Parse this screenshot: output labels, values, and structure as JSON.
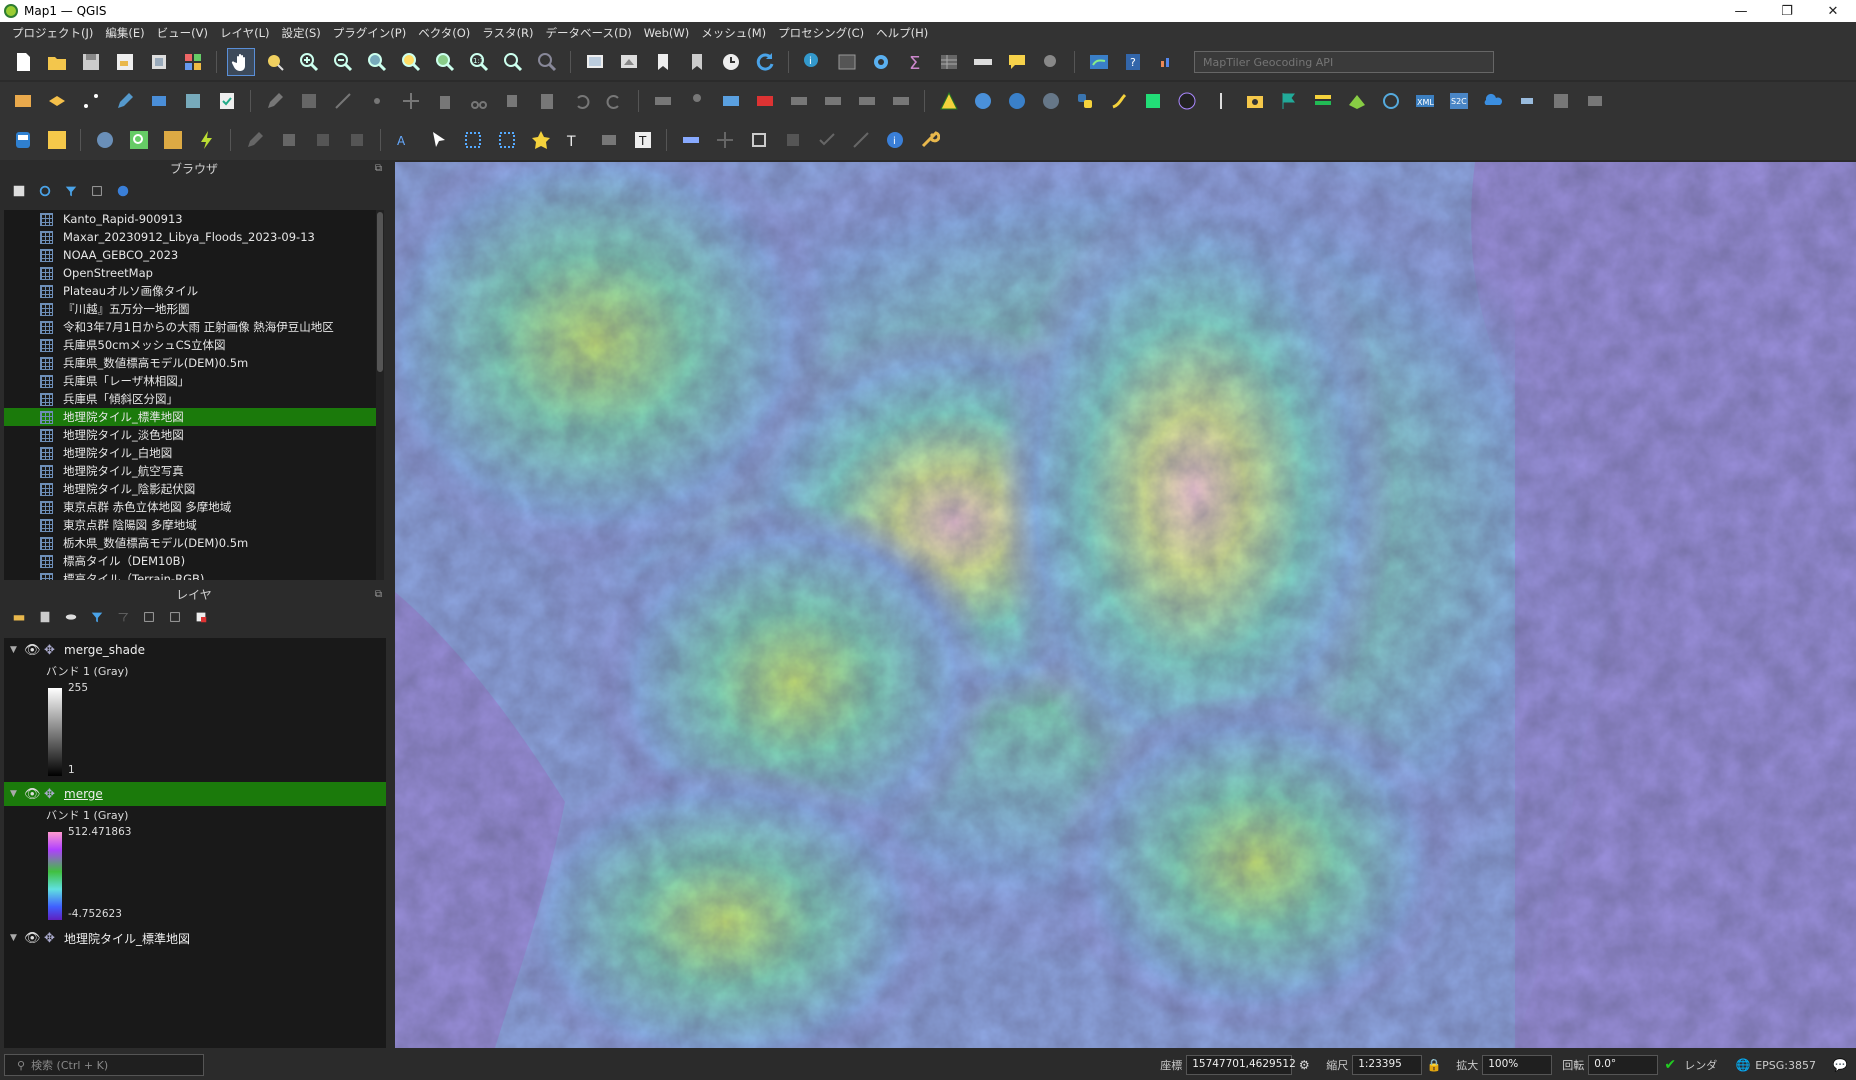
{
  "window": {
    "title": "Map1 — QGIS",
    "minimize": "—",
    "maximize": "❐",
    "close": "✕"
  },
  "menu": [
    "プロジェクト(J)",
    "編集(E)",
    "ビュー(V)",
    "レイヤ(L)",
    "設定(S)",
    "プラグイン(P)",
    "ベクタ(O)",
    "ラスタ(R)",
    "データベース(D)",
    "Web(W)",
    "メッシュ(M)",
    "プロセシング(C)",
    "ヘルプ(H)"
  ],
  "geocoder": {
    "placeholder": "MapTiler Geocoding API"
  },
  "browser": {
    "title": "ブラウザ",
    "items": [
      "Kanto_Rapid-900913",
      "Maxar_20230912_Libya_Floods_2023-09-13",
      "NOAA_GEBCO_2023",
      "OpenStreetMap",
      "Plateauオルソ画像タイル",
      "『川越』五万分一地形圖",
      "令和3年7月1日からの大雨 正射画像 熱海伊豆山地区",
      "兵庫県50cmメッシュCS立体図",
      "兵庫県_数値標高モデル(DEM)0.5m",
      "兵庫県「レーザ林相図」",
      "兵庫県「傾斜区分図」",
      "地理院タイル_標準地図",
      "地理院タイル_淡色地図",
      "地理院タイル_白地図",
      "地理院タイル_航空写真",
      "地理院タイル_陰影起伏図",
      "東京点群 赤色立体地図 多摩地域",
      "東京点群 陰陽図 多摩地域",
      "栃木県_数値標高モデル(DEM)0.5m",
      "標高タイル（DEM10B)",
      "標高タイル（Terrain-RGB)"
    ],
    "selected_index": 11
  },
  "layers": {
    "title": "レイヤ",
    "items": [
      {
        "name": "merge_shade",
        "band": "バンド 1 (Gray)",
        "max": "255",
        "min": "1"
      },
      {
        "name": "merge",
        "band": "バンド 1 (Gray)",
        "max": "512.471863",
        "min": "-4.752623"
      },
      {
        "name": "地理院タイル_標準地図"
      }
    ]
  },
  "status": {
    "search_placeholder": "検索 (Ctrl + K)",
    "coord_label": "座標",
    "coord_value": "15747701,4629512",
    "scale_label": "縮尺",
    "scale_value": "1:23395",
    "zoom_label": "拡大",
    "zoom_value": "100%",
    "rotation_label": "回転",
    "rotation_value": "0.0°",
    "render_label": "レンダ",
    "crs": "EPSG:3857"
  },
  "colors": {
    "selected": "#1b7a0b",
    "panel": "#2b2b2b",
    "dark": "#191919",
    "map_flat": "#9a8fdc"
  }
}
